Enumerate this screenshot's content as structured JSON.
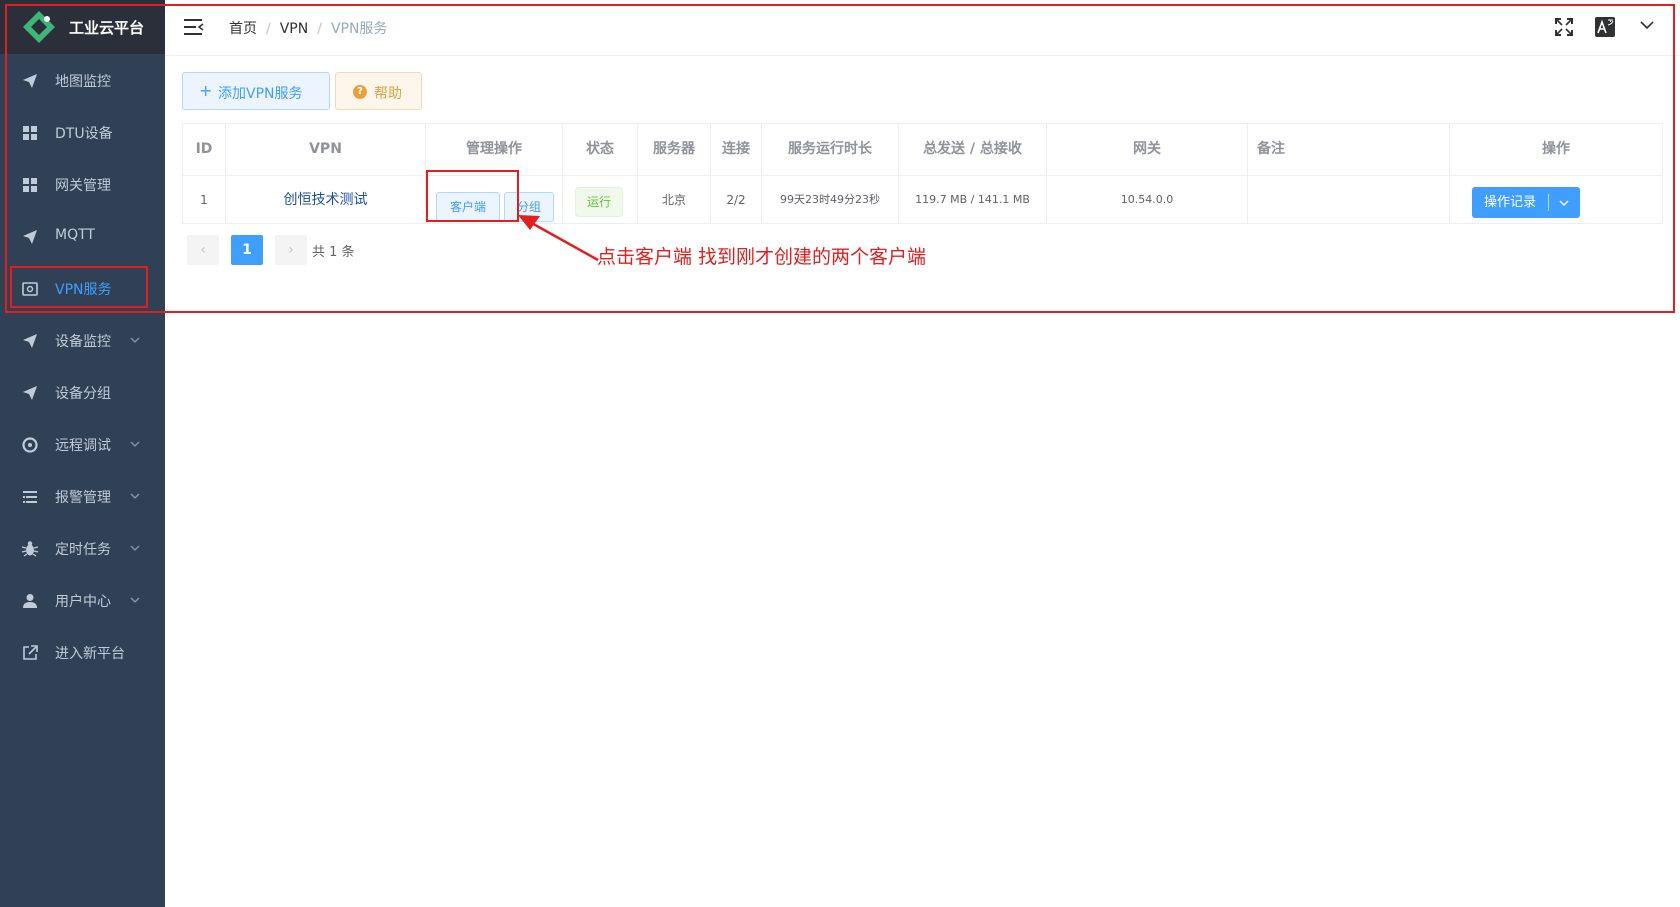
{
  "app": {
    "title": "工业云平台"
  },
  "sidebar": {
    "items": [
      {
        "label": "地图监控",
        "icon": "send-icon",
        "active": false,
        "has_arrow": false
      },
      {
        "label": "DTU设备",
        "icon": "grid-icon",
        "active": false,
        "has_arrow": false
      },
      {
        "label": "网关管理",
        "icon": "grid-icon",
        "active": false,
        "has_arrow": false
      },
      {
        "label": "MQTT",
        "icon": "send-icon",
        "active": false,
        "has_arrow": false
      },
      {
        "label": "VPN服务",
        "icon": "vpn-icon",
        "active": true,
        "has_arrow": false
      },
      {
        "label": "设备监控",
        "icon": "send-icon",
        "active": false,
        "has_arrow": true
      },
      {
        "label": "设备分组",
        "icon": "send-icon",
        "active": false,
        "has_arrow": false
      },
      {
        "label": "远程调试",
        "icon": "target-icon",
        "active": false,
        "has_arrow": true
      },
      {
        "label": "报警管理",
        "icon": "list-icon",
        "active": false,
        "has_arrow": true
      },
      {
        "label": "定时任务",
        "icon": "bug-icon",
        "active": false,
        "has_arrow": true
      },
      {
        "label": "用户中心",
        "icon": "user-icon",
        "active": false,
        "has_arrow": true
      },
      {
        "label": "进入新平台",
        "icon": "external-link-icon",
        "active": false,
        "has_arrow": false
      }
    ]
  },
  "header": {
    "breadcrumb": [
      "首页",
      "VPN",
      "VPN服务"
    ],
    "icons": [
      "fullscreen-icon",
      "translate-icon",
      "chevron-down-icon"
    ]
  },
  "toolbar": {
    "add_label": "添加VPN服务",
    "help_label": "帮助"
  },
  "table": {
    "columns": [
      "ID",
      "VPN",
      "管理操作",
      "状态",
      "服务器",
      "连接",
      "服务运行时长",
      "总发送 / 总接收",
      "网关",
      "备注",
      "操作"
    ],
    "rows": [
      {
        "id": "1",
        "vpn": "创恒技术测试",
        "client_btn": "客户端",
        "group_btn": "分组",
        "status": "运行",
        "server": "北京",
        "connections": "2/2",
        "uptime": "99天23时49分23秒",
        "traffic": "119.7 MB / 141.1 MB",
        "gateway": "10.54.0.0",
        "remark": "",
        "op_label": "操作记录"
      }
    ]
  },
  "pagination": {
    "current": "1",
    "total_text": "共 1 条"
  },
  "annotation": {
    "text": "点击客户端 找到刚才创建的两个客户端"
  },
  "colors": {
    "sidebar_bg": "#304156",
    "primary": "#409eff",
    "annotation_red": "#e02020"
  }
}
